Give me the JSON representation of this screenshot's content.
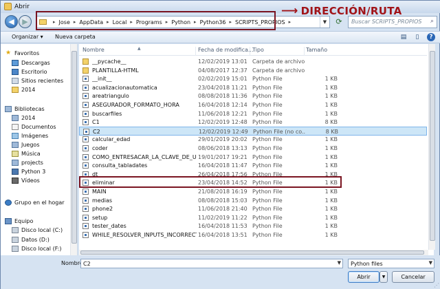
{
  "window": {
    "title": "Abrir"
  },
  "annotation": {
    "arrow": "⟶",
    "text": "DIRECCIÓN/RUTA"
  },
  "address_bar": {
    "crumbs": [
      "Jose",
      "AppData",
      "Local",
      "Programs",
      "Python",
      "Python36",
      "SCRIPTS_PROPIOS"
    ],
    "search_placeholder": "Buscar SCRIPTS_PROPIOS"
  },
  "toolbar": {
    "organize_label": "Organizar ▾",
    "new_folder_label": "Nueva carpeta"
  },
  "nav": {
    "favorites": {
      "label": "Favoritos",
      "items": [
        "Descargas",
        "Escritorio",
        "Sitios recientes",
        "2014"
      ]
    },
    "libraries": {
      "label": "Bibliotecas",
      "items": [
        "2014",
        "Documentos",
        "Imágenes",
        "Juegos",
        "Música",
        "projects",
        "Python 3",
        "Vídeos"
      ]
    },
    "homegroup": "Grupo en el hogar",
    "computer": {
      "label": "Equipo",
      "items": [
        "Disco local (C:)",
        "Datos (D:)",
        "Disco local (F:)"
      ]
    }
  },
  "columns": {
    "name": "Nombre",
    "date": "Fecha de modifica...",
    "type": "Tipo",
    "size": "Tamaño"
  },
  "files": [
    {
      "name": "__pycache__",
      "date": "12/02/2019 13:01",
      "type": "Carpeta de archivos",
      "size": "",
      "kind": "folder"
    },
    {
      "name": "PLANTILLA-HTML",
      "date": "04/08/2017 12:37",
      "type": "Carpeta de archivos",
      "size": "",
      "kind": "folder"
    },
    {
      "name": "__init__",
      "date": "02/02/2019 15:01",
      "type": "Python File",
      "size": "1 KB",
      "kind": "py"
    },
    {
      "name": "acualizacionautomatica",
      "date": "23/04/2018 11:21",
      "type": "Python File",
      "size": "1 KB",
      "kind": "py"
    },
    {
      "name": "areatriangulo",
      "date": "08/08/2018 11:36",
      "type": "Python File",
      "size": "1 KB",
      "kind": "py"
    },
    {
      "name": "ASEGURADOR_FORMATO_HORA",
      "date": "16/04/2018 12:14",
      "type": "Python File",
      "size": "1 KB",
      "kind": "py"
    },
    {
      "name": "buscarfiles",
      "date": "11/06/2018 12:21",
      "type": "Python File",
      "size": "1 KB",
      "kind": "py"
    },
    {
      "name": "C1",
      "date": "12/02/2019 12:48",
      "type": "Python File",
      "size": "8 KB",
      "kind": "py"
    },
    {
      "name": "C2",
      "date": "12/02/2019 12:49",
      "type": "Python File (no co...",
      "size": "8 KB",
      "kind": "py",
      "selected": true
    },
    {
      "name": "calcular_edad",
      "date": "29/01/2019 20:02",
      "type": "Python File",
      "size": "1 KB",
      "kind": "py"
    },
    {
      "name": "coder",
      "date": "08/06/2018 13:13",
      "type": "Python File",
      "size": "1 KB",
      "kind": "py"
    },
    {
      "name": "COMO_ENTRESACAR_LA_CLAVE_DE_UN...",
      "date": "19/01/2017 19:21",
      "type": "Python File",
      "size": "1 KB",
      "kind": "py"
    },
    {
      "name": "consulta_tabladates",
      "date": "16/04/2018 11:47",
      "type": "Python File",
      "size": "1 KB",
      "kind": "py"
    },
    {
      "name": "dt",
      "date": "26/04/2018 17:56",
      "type": "Python File",
      "size": "1 KB",
      "kind": "py"
    },
    {
      "name": "eliminar",
      "date": "23/04/2018 14:52",
      "type": "Python File",
      "size": "1 KB",
      "kind": "py"
    },
    {
      "name": "MAIN",
      "date": "21/08/2018 16:19",
      "type": "Python File",
      "size": "1 KB",
      "kind": "py"
    },
    {
      "name": "medias",
      "date": "08/08/2018 15:03",
      "type": "Python File",
      "size": "1 KB",
      "kind": "py"
    },
    {
      "name": "phone2",
      "date": "11/06/2018 21:40",
      "type": "Python File",
      "size": "1 KB",
      "kind": "py"
    },
    {
      "name": "setup",
      "date": "11/02/2019 11:22",
      "type": "Python File",
      "size": "1 KB",
      "kind": "py"
    },
    {
      "name": "tester_dates",
      "date": "16/04/2018 11:53",
      "type": "Python File",
      "size": "1 KB",
      "kind": "py"
    },
    {
      "name": "WHILE_RESOLVER_INPUTS_INCORRECTO...",
      "date": "16/04/2018 13:51",
      "type": "Python File",
      "size": "1 KB",
      "kind": "py"
    }
  ],
  "bottom": {
    "filename_label": "Nombre:",
    "filename_value": "C2",
    "filetype_value": "Python files",
    "open_label": "Abrir",
    "open_dropdown": "▼",
    "cancel_label": "Cancelar"
  },
  "colors": {
    "annotation": "#a11318",
    "selection": "#cde6f7"
  }
}
